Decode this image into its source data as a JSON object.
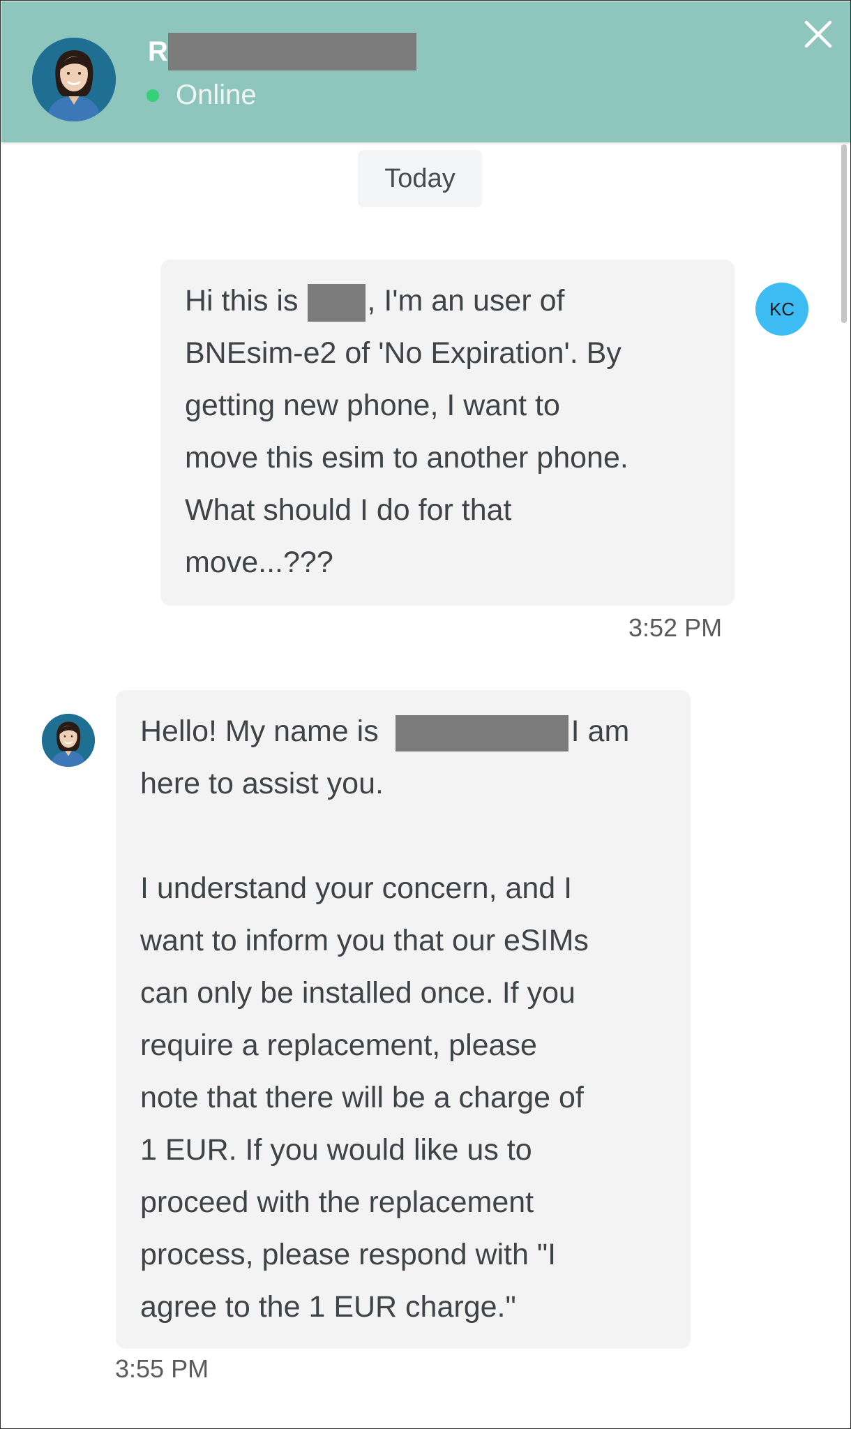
{
  "header": {
    "agent_name_initial": "R",
    "status": "Online",
    "status_color": "#34d07a",
    "background_color": "#8ec5bd",
    "close_icon": "close-icon"
  },
  "date_divider": "Today",
  "messages": [
    {
      "sender": "user",
      "avatar_initials": "KC",
      "lines": [
        [
          "Hi this is ",
          ", I'm an user of"
        ],
        "BNEsim-e2 of 'No Expiration'. By",
        "getting new phone, I want to",
        "move this esim to another phone.",
        "What should I do for that",
        "move...???"
      ],
      "time": "3:52 PM"
    },
    {
      "sender": "agent",
      "lines": [
        [
          "Hello! My name is ",
          "I am"
        ],
        "here to assist you.",
        "",
        "I understand your concern, and I",
        "want to inform you that our eSIMs",
        "can only be installed once. If you",
        "require a replacement, please",
        "note that there will be a charge of",
        "1 EUR. If you would like us to",
        "proceed with the replacement",
        "process, please respond with \"I",
        "agree to the 1 EUR charge.\""
      ],
      "time": "3:55 PM"
    }
  ]
}
